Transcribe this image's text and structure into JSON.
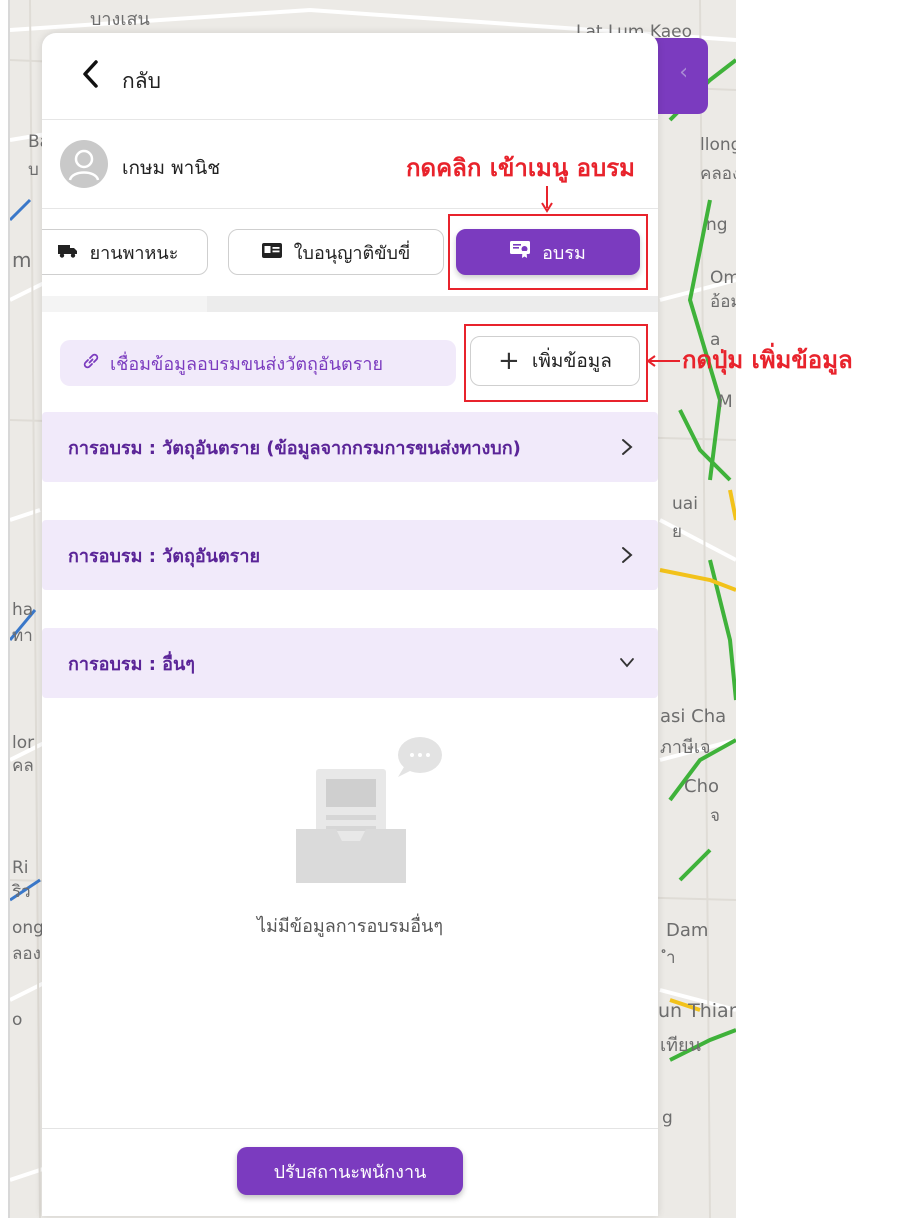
{
  "map": {
    "labels": [
      "บางเสน",
      "Lat Lum Kaeo",
      "Ba",
      "บ",
      "m",
      "llong",
      "คลอง",
      "ng",
      "Om",
      "อ้อม",
      "a",
      "M",
      "uai",
      "ย",
      "ha",
      "ทา",
      "lor",
      "คล",
      "asi Cha",
      "ภาษีเจ",
      "Cho",
      "จ",
      "Ri",
      "ริว",
      "ong",
      "ลอง",
      "Dam",
      "ำ",
      "un Thian",
      "เทียน",
      "g",
      "o"
    ],
    "collapse_icon": "chevron-left-icon"
  },
  "panel": {
    "back_label": "กลับ",
    "user_name": "เกษม พานิช",
    "tabs": [
      {
        "label": "ยานพาหนะ",
        "icon": "truck-icon"
      },
      {
        "label": "ใบอนุญาติขับขี่",
        "icon": "id-card-icon"
      },
      {
        "label": "อบรม",
        "icon": "certificate-icon"
      }
    ],
    "link_text": "เชื่อมข้อมูลอบรมขนส่งวัตถุอันตราย",
    "add_label": "เพิ่มข้อมูล",
    "accordions": [
      {
        "title": "การอบรม : วัตถุอันตราย (ข้อมูลจากกรมการขนส่งทางบก)",
        "state": "collapsed"
      },
      {
        "title": "การอบรม : วัตถุอันตราย",
        "state": "collapsed"
      },
      {
        "title": "การอบรม : อื่นๆ",
        "state": "expanded"
      }
    ],
    "empty_text": "ไม่มีข้อมูลการอบรมอื่นๆ",
    "footer_button": "ปรับสถานะพนักงาน"
  },
  "annotations": {
    "menu_note": "กดคลิก เข้าเมนู อบรม",
    "button_note": "กดปุ่ม เพิ่มข้อมูล",
    "color": "#e8232c"
  },
  "colors": {
    "primary": "#7b3bbf",
    "primary_light": "#f1eafa",
    "accordion_title": "#5b2598"
  }
}
